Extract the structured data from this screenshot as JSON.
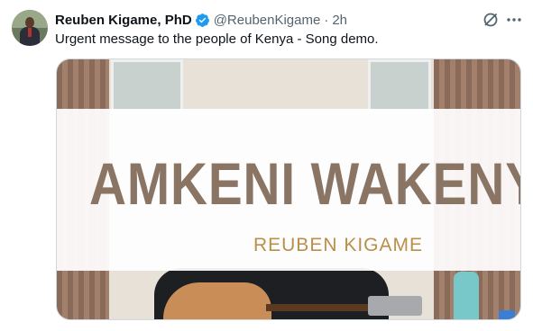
{
  "author": {
    "name": "Reuben Kigame, PhD",
    "handle": "@ReubenKigame",
    "separator": "·",
    "time": "2h"
  },
  "tweet": {
    "text": "Urgent message to the people of Kenya - Song demo."
  },
  "media": {
    "title": "AMKENI WAKENYA",
    "subtitle": "REUBEN KIGAME"
  },
  "colors": {
    "verified": "#1d9bf0",
    "secondary_text": "#536471",
    "title_text": "#8a7464",
    "subtitle_text": "#b98f4a"
  },
  "icons": [
    "verified-badge-icon",
    "grok-icon",
    "more-options-icon"
  ]
}
